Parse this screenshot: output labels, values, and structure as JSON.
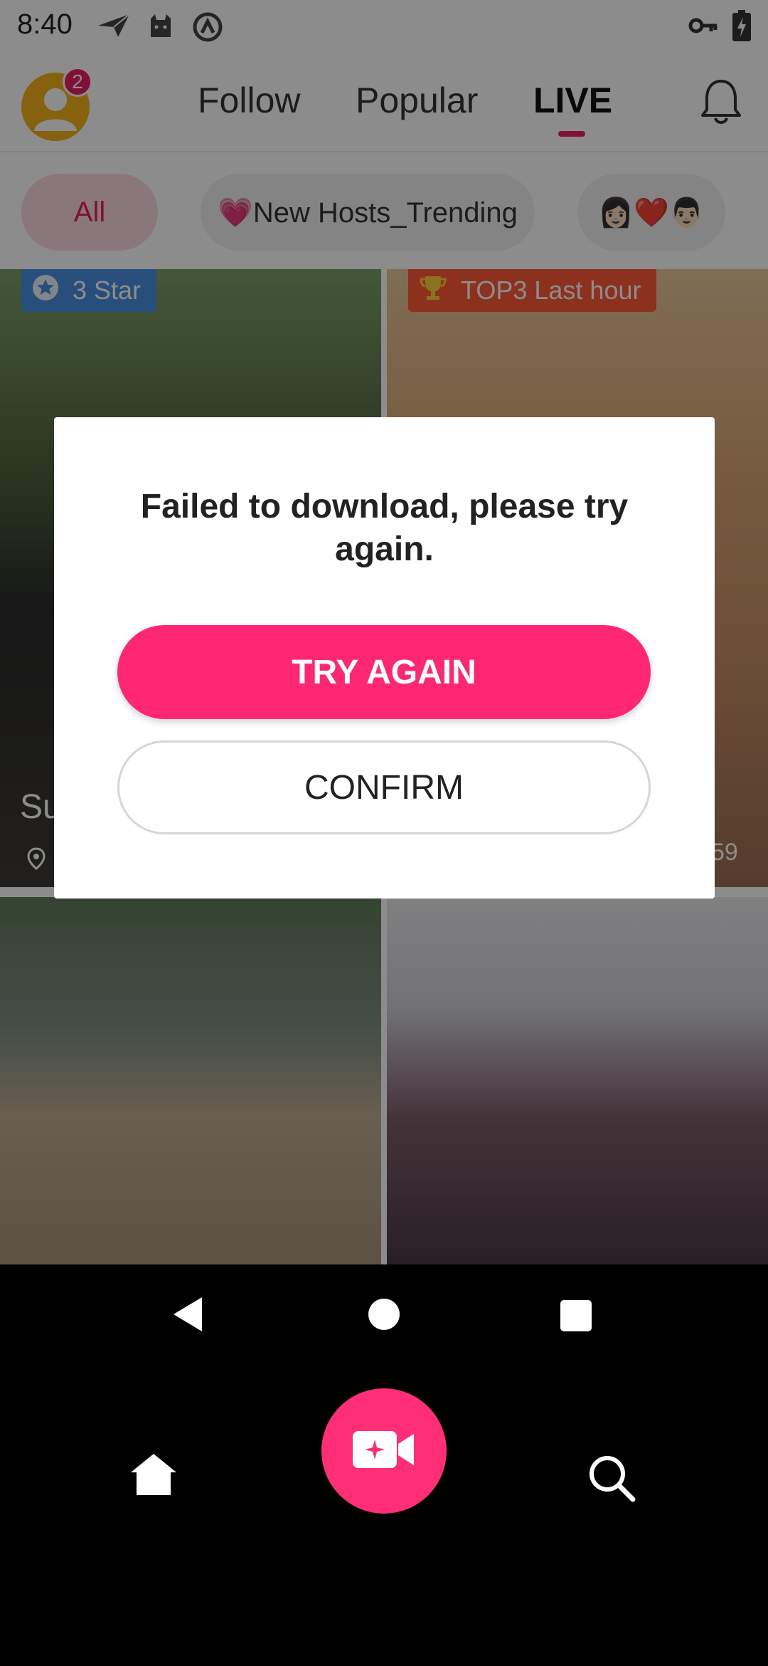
{
  "status_bar": {
    "time": "8:40",
    "left_icons": [
      "send-icon",
      "cat-icon",
      "vpn-circle-icon"
    ],
    "right_icons": [
      "key-icon",
      "battery-charging-icon"
    ]
  },
  "header": {
    "notification_count": "2",
    "tabs": [
      {
        "label": "Follow",
        "active": false
      },
      {
        "label": "Popular",
        "active": false
      },
      {
        "label": "LIVE",
        "active": true
      }
    ],
    "bell_icon": "bell-icon"
  },
  "chips": [
    {
      "label": "All",
      "active": true
    },
    {
      "label": "💗New Hosts_Trending",
      "active": false
    },
    {
      "label": "👩🏻❤️👨🏻",
      "active": false
    }
  ],
  "cards": [
    {
      "tag": "3 Star",
      "tag_color": "#4a90e2",
      "name": "Su",
      "has_location": true
    },
    {
      "tag": "TOP3 Last hour",
      "tag_color": "#ff5a36",
      "count": "59"
    },
    {
      "tag": ""
    },
    {
      "tag": ""
    }
  ],
  "dialog": {
    "message": "Failed to download, please try again.",
    "primary_button": "TRY AGAIN",
    "secondary_button": "CONFIRM"
  },
  "bottom_nav": {
    "icons": [
      "home-icon",
      "live-camera-icon",
      "search-icon"
    ]
  },
  "colors": {
    "accent": "#ff2673",
    "badge": "#e91e63",
    "avatar": "#f5b31b"
  }
}
